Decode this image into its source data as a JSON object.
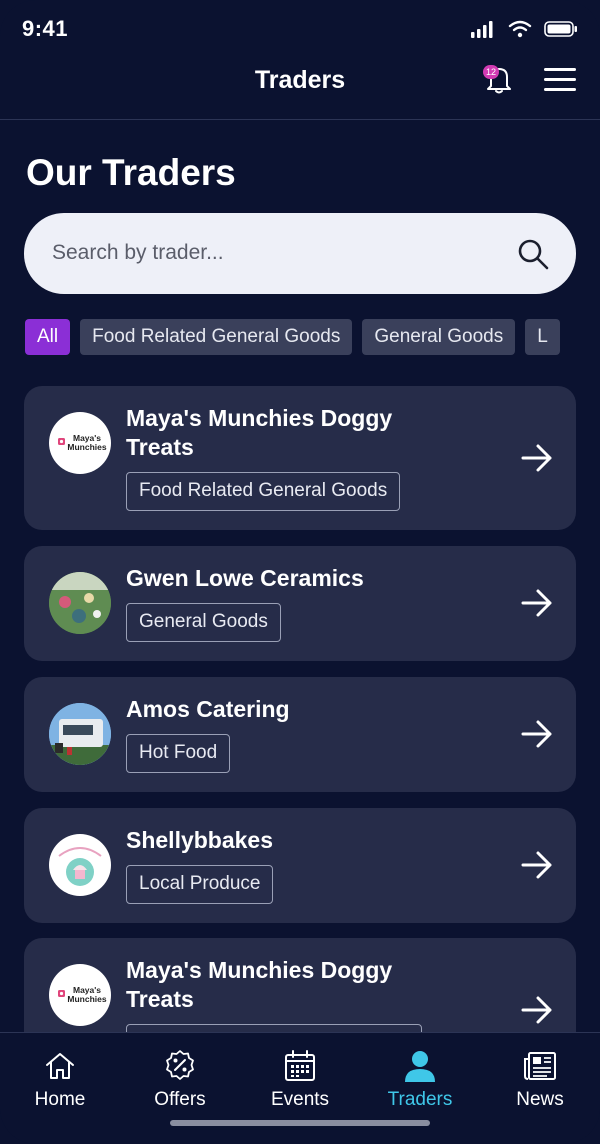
{
  "status_bar": {
    "time": "9:41"
  },
  "header": {
    "title": "Traders",
    "notification_count": "12"
  },
  "page": {
    "title": "Our Traders"
  },
  "search": {
    "placeholder": "Search by trader..."
  },
  "filters": [
    {
      "label": "All",
      "active": true
    },
    {
      "label": "Food Related General Goods",
      "active": false
    },
    {
      "label": "General Goods",
      "active": false
    },
    {
      "label": "L",
      "active": false
    }
  ],
  "traders": [
    {
      "name": "Maya's Munchies Doggy Treats",
      "category": "Food Related General Goods",
      "logo_icon": "mayas-munchies-logo"
    },
    {
      "name": "Gwen Lowe Ceramics",
      "category": "General Goods",
      "logo_icon": "ceramics-photo"
    },
    {
      "name": "Amos Catering",
      "category": "Hot Food",
      "logo_icon": "catering-van-photo"
    },
    {
      "name": "Shellybbakes",
      "category": "Local Produce",
      "logo_icon": "shellybbakes-logo"
    },
    {
      "name": "Maya's Munchies Doggy Treats",
      "category": "",
      "logo_icon": "mayas-munchies-logo"
    }
  ],
  "logo_text": {
    "maya_line1": "Maya's",
    "maya_line2": "Munchies"
  },
  "tabbar": [
    {
      "label": "Home",
      "icon": "home-icon",
      "active": false
    },
    {
      "label": "Offers",
      "icon": "offers-icon",
      "active": false
    },
    {
      "label": "Events",
      "icon": "calendar-icon",
      "active": false
    },
    {
      "label": "Traders",
      "icon": "user-icon",
      "active": true
    },
    {
      "label": "News",
      "icon": "newspaper-icon",
      "active": false
    }
  ],
  "colors": {
    "background": "#0b1230",
    "card": "#262c49",
    "accent_chip": "#8b2fd6",
    "active_tab": "#3fc7e8",
    "badge": "#d23bb3"
  }
}
